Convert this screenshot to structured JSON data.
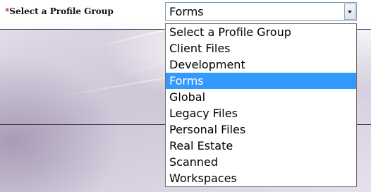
{
  "form": {
    "required_marker": "*",
    "label": "Select a Profile Group"
  },
  "select": {
    "current_value": "Forms",
    "dropdown_icon": "chevron-down-icon",
    "options": [
      {
        "label": "Select a Profile Group",
        "selected": false
      },
      {
        "label": "Client Files",
        "selected": false
      },
      {
        "label": "Development",
        "selected": false
      },
      {
        "label": "Forms",
        "selected": true
      },
      {
        "label": "Global",
        "selected": false
      },
      {
        "label": "Legacy Files",
        "selected": false
      },
      {
        "label": "Personal Files",
        "selected": false
      },
      {
        "label": "Real Estate",
        "selected": false
      },
      {
        "label": "Scanned",
        "selected": false
      },
      {
        "label": "Workspaces",
        "selected": false
      }
    ]
  },
  "colors": {
    "highlight": "#3399ff",
    "required": "#cc2222"
  }
}
